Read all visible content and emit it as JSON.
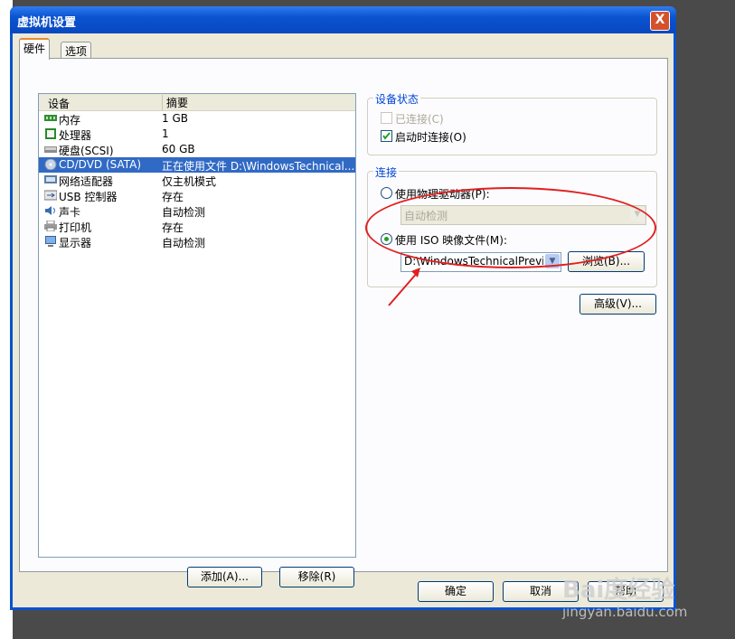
{
  "window": {
    "title": "虚拟机设置",
    "close_label": "X"
  },
  "tabs": [
    {
      "label": "硬件"
    },
    {
      "label": "选项"
    }
  ],
  "device_list": {
    "columns": [
      "设备",
      "摘要"
    ],
    "rows": [
      {
        "name": "内存",
        "summary": "1 GB",
        "icon": "memory-icon"
      },
      {
        "name": "处理器",
        "summary": "1",
        "icon": "processor-icon"
      },
      {
        "name": "硬盘(SCSI)",
        "summary": "60 GB",
        "icon": "harddisk-icon"
      },
      {
        "name": "CD/DVD (SATA)",
        "summary": "正在使用文件 D:\\WindowsTechnical...",
        "icon": "cd-dvd-icon",
        "selected": true
      },
      {
        "name": "网络适配器",
        "summary": "仅主机模式",
        "icon": "network-adapter-icon"
      },
      {
        "name": "USB 控制器",
        "summary": "存在",
        "icon": "usb-icon"
      },
      {
        "name": "声卡",
        "summary": "自动检测",
        "icon": "sound-card-icon"
      },
      {
        "name": "打印机",
        "summary": "存在",
        "icon": "printer-icon"
      },
      {
        "name": "显示器",
        "summary": "自动检测",
        "icon": "monitor-icon"
      }
    ]
  },
  "list_buttons": {
    "add": "添加(A)...",
    "remove": "移除(R)"
  },
  "device_status": {
    "label": "设备状态",
    "connected": {
      "label": "已连接(C)",
      "checked": false,
      "disabled": true
    },
    "connect_at_power_on": {
      "label": "启动时连接(O)",
      "checked": true
    }
  },
  "connection": {
    "label": "连接",
    "physical_drive": {
      "label": "使用物理驱动器(P):",
      "selected": false,
      "dropdown_value": "自动检测"
    },
    "iso_image": {
      "label": "使用 ISO 映像文件(M):",
      "selected": true,
      "path": "D:\\WindowsTechnicalPreview"
    },
    "browse_label": "浏览(B)..."
  },
  "advanced_label": "高级(V)...",
  "footer": {
    "ok": "确定",
    "cancel": "取消",
    "help": "帮助"
  },
  "watermark": {
    "brand": "Bai度经验",
    "url": "jingyan.baidu.com"
  },
  "colors": {
    "annotation_red": "#e02020",
    "title_blue": "#0a53d0",
    "selection": "#316ac5"
  }
}
